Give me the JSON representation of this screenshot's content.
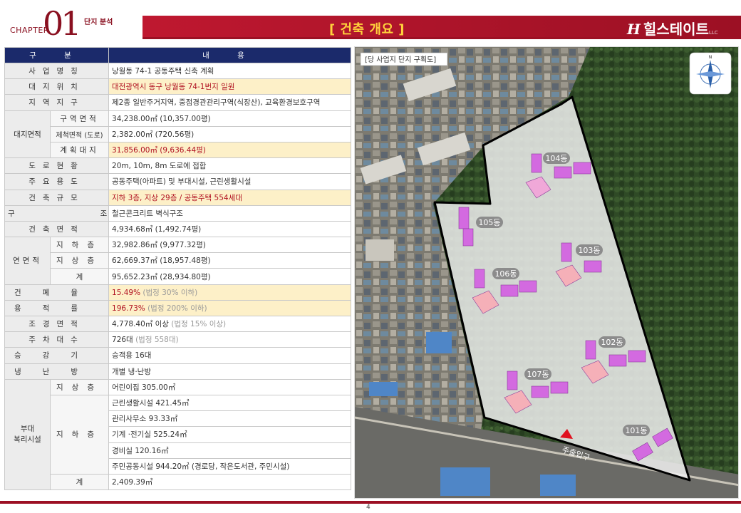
{
  "header": {
    "chapter_word": "CHAPTER",
    "chapter_num": "01",
    "chapter_sub": "단지 분석",
    "title": "[ 건축 개요 ]",
    "brand": "힐스테이트",
    "brand_logo": "H",
    "brand_small": "LLC"
  },
  "table": {
    "headers": [
      "구 분",
      "내 용"
    ],
    "rows": {
      "r1": {
        "cat": "사업명칭",
        "val": "낭월동 74-1 공동주택 신축 계획"
      },
      "r2": {
        "cat": "대지위치",
        "val": "대전광역시 동구 낭월동 74-1번지 일원"
      },
      "r3": {
        "cat": "지역지구",
        "val": "제2종 일반주거지역, 중점경관관리구역(식장산), 교육환경보호구역"
      },
      "r4": {
        "cat": "대지면적",
        "sub": "구역면적",
        "val": "34,238.00㎡ (10,357.00평)"
      },
      "r5": {
        "sub": "제척면적 (도로)",
        "val": "2,382.00㎡ (720.56평)"
      },
      "r6": {
        "sub": "계획대지",
        "val": "31,856.00㎡ (9,636.44평)"
      },
      "r7": {
        "cat": "도로현황",
        "val": "20m, 10m, 8m 도로에 접합"
      },
      "r8": {
        "cat": "주요용도",
        "val": "공동주택(아파트) 및 부대시설, 근린생활시설"
      },
      "r9": {
        "cat": "건축규모",
        "val": "지하 3층, 지상 29층 / 공동주택 554세대"
      },
      "r10": {
        "cat": "구조",
        "val": "철근콘크리트 벽식구조"
      },
      "r11": {
        "cat": "건축면적",
        "val": "4,934.68㎡ (1,492.74평)"
      },
      "r12": {
        "cat": "연면적",
        "sub": "지하층",
        "val": "32,982.86㎡ (9,977.32평)"
      },
      "r13": {
        "sub": "지상층",
        "val": "62,669.37㎡ (18,957.48평)"
      },
      "r14": {
        "sub": "계",
        "val": "95,652.23㎡ (28,934.80평)"
      },
      "r15": {
        "cat": "건폐율",
        "val": "15.49%",
        "note": "(법정 30% 이하)"
      },
      "r16": {
        "cat": "용적률",
        "val": "196.73%",
        "note": "(법정 200% 이하)"
      },
      "r17": {
        "cat": "조경면적",
        "val": "4,778.40㎡ 이상",
        "note": "(법정 15% 이상)"
      },
      "r18": {
        "cat": "주차대수",
        "val": "726대",
        "note": "(법정 558대)"
      },
      "r19": {
        "cat": "승강기",
        "val": "승객용 16대"
      },
      "r20": {
        "cat": "냉난방",
        "val": "개별 냉·난방"
      },
      "r21": {
        "cat": "부대\n복리시설",
        "sub": "지상층",
        "val": "어린이집 305.00㎡"
      },
      "r22": {
        "sub": "지하층",
        "val": "근린생활시설 421.45㎡"
      },
      "r23": {
        "val": "관리사무소 93.33㎡"
      },
      "r24": {
        "val": "기계 ·전기실 525.24㎡"
      },
      "r25": {
        "val": "경비실 120.16㎡"
      },
      "r26": {
        "val": "주민공동시설 944.20㎡ (경로당, 작은도서관, 주민시설)"
      },
      "r27": {
        "sub": "계",
        "val": "2,409.39㎡"
      }
    }
  },
  "map": {
    "caption": "[당 사업지 단지 구획도]",
    "compass_n": "N",
    "entrance": "주출입구",
    "buildings": {
      "b101": "101동",
      "b102": "102동",
      "b103": "103동",
      "b104": "104동",
      "b105": "105동",
      "b106": "106동",
      "b107": "107동"
    }
  },
  "footer": {
    "page": "4"
  },
  "colors": {
    "navy": "#1b2a6b",
    "brand_red": "#9c1024",
    "title_yellow": "#ffd23c",
    "highlight": "#fdf0c8",
    "building": "#cc55dd"
  }
}
